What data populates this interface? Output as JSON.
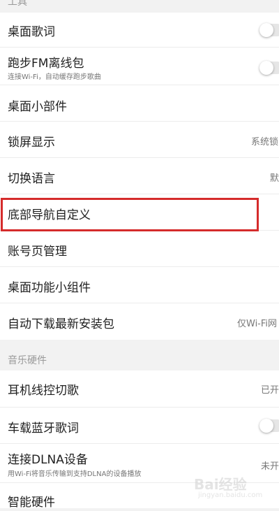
{
  "sections": {
    "tools_header": "工具",
    "music_hardware_header": "音乐硬件"
  },
  "settings": {
    "desktop_lyrics": {
      "title": "桌面歌词",
      "toggle_on": false
    },
    "running_fm": {
      "title": "跑步FM离线包",
      "subtitle": "连接Wi-Fi，自动缓存跑步歌曲",
      "toggle_on": false
    },
    "desktop_widget": {
      "title": "桌面小部件"
    },
    "lockscreen": {
      "title": "锁屏显示",
      "value": "系统锁"
    },
    "language": {
      "title": "切换语言",
      "value": "默"
    },
    "bottom_nav": {
      "title": "底部导航自定义"
    },
    "account_page": {
      "title": "账号页管理"
    },
    "desktop_function_widget": {
      "title": "桌面功能小组件"
    },
    "auto_download": {
      "title": "自动下载最新安装包",
      "value": "仅Wi-Fi网"
    },
    "headset_control": {
      "title": "耳机线控切歌",
      "value": "已开"
    },
    "car_bluetooth": {
      "title": "车载蓝牙歌词",
      "toggle_on": false
    },
    "dlna": {
      "title": "连接DLNA设备",
      "subtitle": "用Wi-Fi将音乐传输到支持DLNA的设备播放",
      "value": "未开"
    },
    "smart_hardware": {
      "title": "智能硬件"
    }
  },
  "watermark": {
    "text": "Bai经验",
    "url": "jingyan.baidu.com"
  },
  "colors": {
    "highlight": "#d52b2b",
    "background": "#f2f2f2",
    "card": "#ffffff"
  }
}
